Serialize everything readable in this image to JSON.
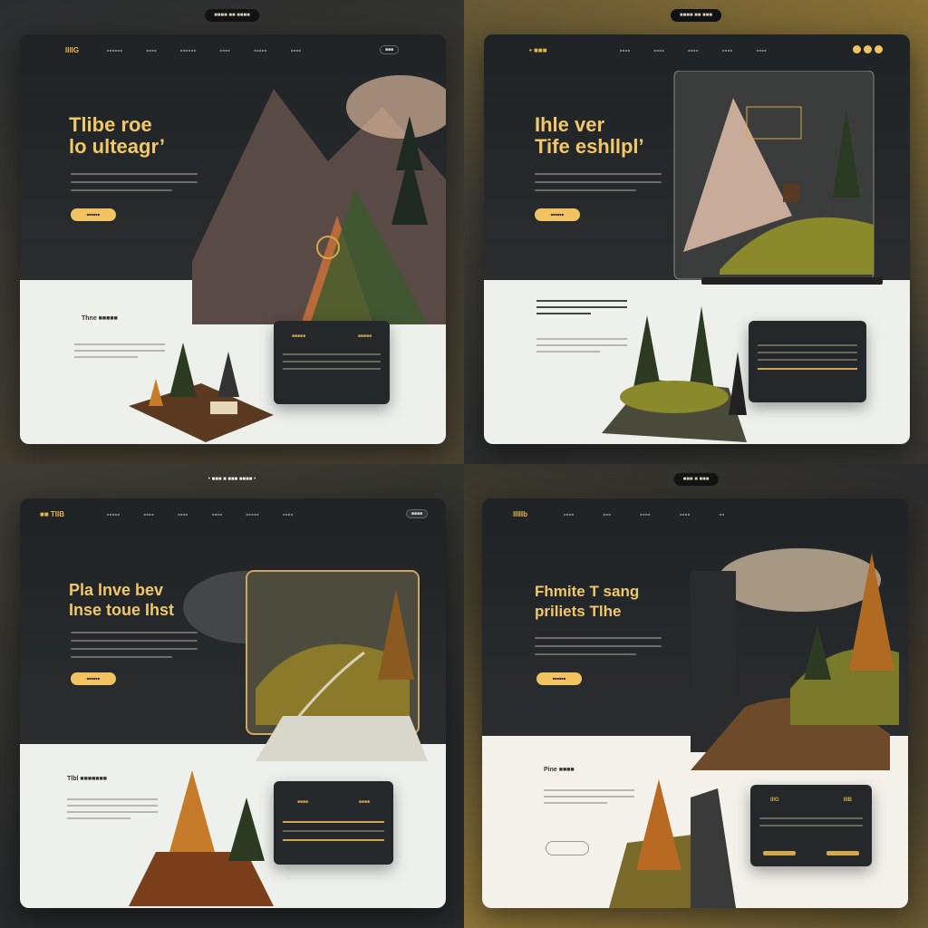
{
  "quadrants": [
    {
      "top_pill": "■■■■ ■■ ■■■■",
      "logo": "IIIIG",
      "nav": [
        "■■■■■■",
        "■■■■",
        "■■■■■■",
        "■■■■",
        "■■■■■",
        "■■■■"
      ],
      "nav_cta": "■■■",
      "headline": "Tlibe roe\nlo ulteagr’",
      "cta": "■■■■■■",
      "section_title": "Thne ■■■■■",
      "panel_left_title": "■■■■■",
      "panel_right_title": "■■■■■"
    },
    {
      "top_pill": "■■■■ ■■ ■■■",
      "logo": "• ■■■",
      "nav": [
        "■■■■",
        "■■■■",
        "■■■■",
        "■■■■",
        "■■■■"
      ],
      "headline": "Ihle  ver\nTife eshllpl’",
      "cta": "■■■■■■",
      "section_lines": "■■■■ ■■■ ■■■■■■",
      "panel_title": "■■■■■■"
    },
    {
      "top_pill": "• ■■■ ■ ■■■ ■■■■ •",
      "logo": "■■ TIIB",
      "nav": [
        "■■■■■",
        "■■■■",
        "■■■■",
        "■■■■",
        "■■■■■",
        "■■■■"
      ],
      "nav_cta": "■■■■",
      "headline": "Pla lnve bev\nInse toue Ihst",
      "cta": "■■■■■■",
      "section_title": "Tlbl ■■■■■■■",
      "panel_left_title": "■■■■",
      "panel_right_title": "■■■■"
    },
    {
      "top_pill": "■■■ ■ ■■■",
      "logo": "IIIIIb",
      "nav": [
        "■■■■",
        "■■■",
        "■■■■",
        "■■■■",
        "■■"
      ],
      "headline": "Fhmite T sang\npriliets Tlhe",
      "cta": "■■■■■■",
      "section_title": "Pine ■■■■",
      "panel_left_title": "IIIG",
      "panel_right_title": "IIIB"
    }
  ],
  "colors": {
    "accent": "#f2c461",
    "dark_card": "#1f2326",
    "light_section": "#eef0ec"
  }
}
